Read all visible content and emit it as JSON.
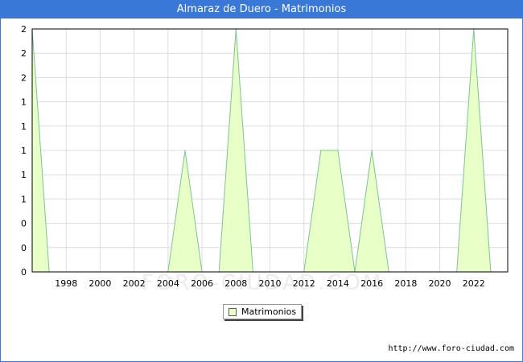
{
  "header": {
    "title": "Almaraz de Duero - Matrimonios"
  },
  "watermark": "FORO-CIUDAD.COM",
  "source_url": "http://www.foro-ciudad.com",
  "legend": {
    "label": "Matrimonios"
  },
  "colors": {
    "title_bar": "#3a78d8",
    "area_fill": "#e8ffc8",
    "area_stroke": "#7cc494",
    "grid": "#dcdcdc"
  },
  "chart_data": {
    "type": "area",
    "title": "Almaraz de Duero - Matrimonios",
    "xlabel": "",
    "ylabel": "",
    "x": [
      1996,
      1997,
      1998,
      1999,
      2000,
      2001,
      2002,
      2003,
      2004,
      2005,
      2006,
      2007,
      2008,
      2009,
      2010,
      2011,
      2012,
      2013,
      2014,
      2015,
      2016,
      2017,
      2018,
      2019,
      2020,
      2021,
      2022,
      2023
    ],
    "series": [
      {
        "name": "Matrimonios",
        "values": [
          2,
          0,
          0,
          0,
          0,
          0,
          0,
          0,
          0,
          1,
          0,
          0,
          2,
          0,
          0,
          0,
          0,
          1,
          1,
          0,
          1,
          0,
          0,
          0,
          0,
          0,
          2,
          0
        ]
      }
    ],
    "xlim": [
      1996,
      2024
    ],
    "ylim": [
      0,
      2
    ],
    "x_tick_labels": [
      "1998",
      "2000",
      "2002",
      "2004",
      "2006",
      "2008",
      "2010",
      "2012",
      "2014",
      "2016",
      "2018",
      "2020",
      "2022"
    ],
    "y_tick_labels": [
      "0",
      "0",
      "0",
      "1",
      "1",
      "1",
      "1",
      "1",
      "2",
      "2",
      "2"
    ],
    "grid": true,
    "legend_position": "bottom-center"
  }
}
